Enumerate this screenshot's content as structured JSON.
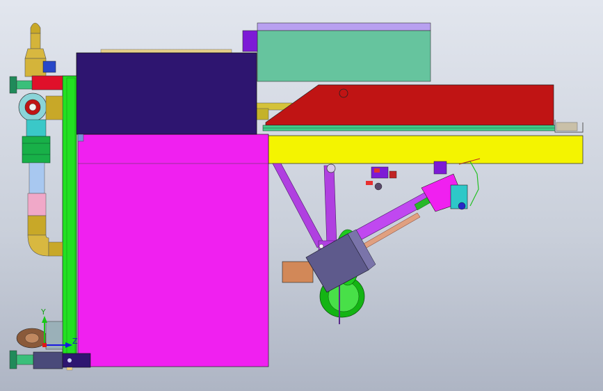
{
  "viewport": {
    "title": "",
    "view": "side-elevation"
  },
  "triad": {
    "y_label": "Y",
    "z_label": "Z",
    "y_color": "#18c818",
    "z_color": "#1818e0"
  },
  "palette": {
    "background_top": "#e2e6ee",
    "background_bottom": "#aeb5c4",
    "frame_green": "#22e022",
    "body_magenta": "#f020f0",
    "rail_yellow": "#f4f400",
    "tray_red": "#c01414",
    "hood_navy": "#2e1570",
    "box_teal": "#66c49e",
    "pipe_violet": "#b040e0"
  },
  "parts": [
    "cabinet-body",
    "control-hood",
    "side-frame",
    "pipe-assembly",
    "top-lid",
    "teal-box",
    "red-tray",
    "yellow-rail",
    "support-arms",
    "pump-motor",
    "fan-housing",
    "flange-plate",
    "inclined-shaft"
  ]
}
